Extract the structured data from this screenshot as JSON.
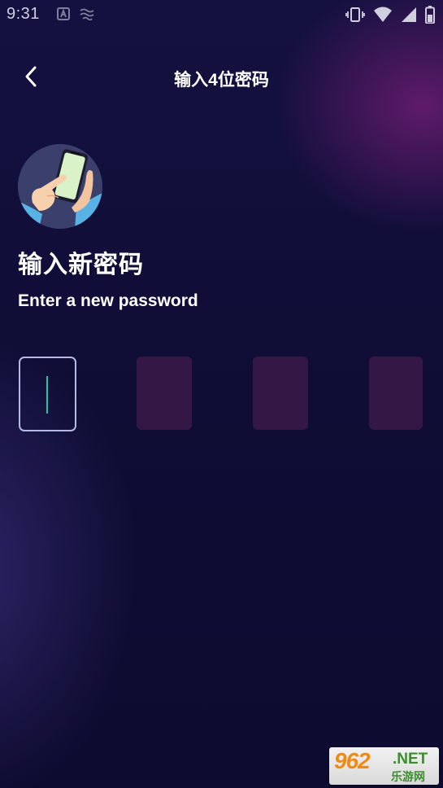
{
  "status_bar": {
    "time": "9:31",
    "left_icons": [
      "notification-a-icon",
      "notification-wave-icon"
    ],
    "right_icons": [
      "vibrate-icon",
      "wifi-icon",
      "signal-icon",
      "battery-icon"
    ]
  },
  "nav": {
    "back_icon": "chevron-left-icon",
    "title": "输入4位密码"
  },
  "content": {
    "avatar_icon": "hands-phone-illustration",
    "heading": "输入新密码",
    "subheading": "Enter a new password",
    "pin_length": 4,
    "active_index": 0
  },
  "watermark": {
    "number": "962",
    "net": ".NET",
    "cn": "乐游网"
  },
  "colors": {
    "background": "#0f0d33",
    "accent_purple": "#5a1a63",
    "pin_box_fill": "#341745",
    "pin_box_active_border": "#b6b8e6",
    "cursor": "#1fc7a9"
  }
}
